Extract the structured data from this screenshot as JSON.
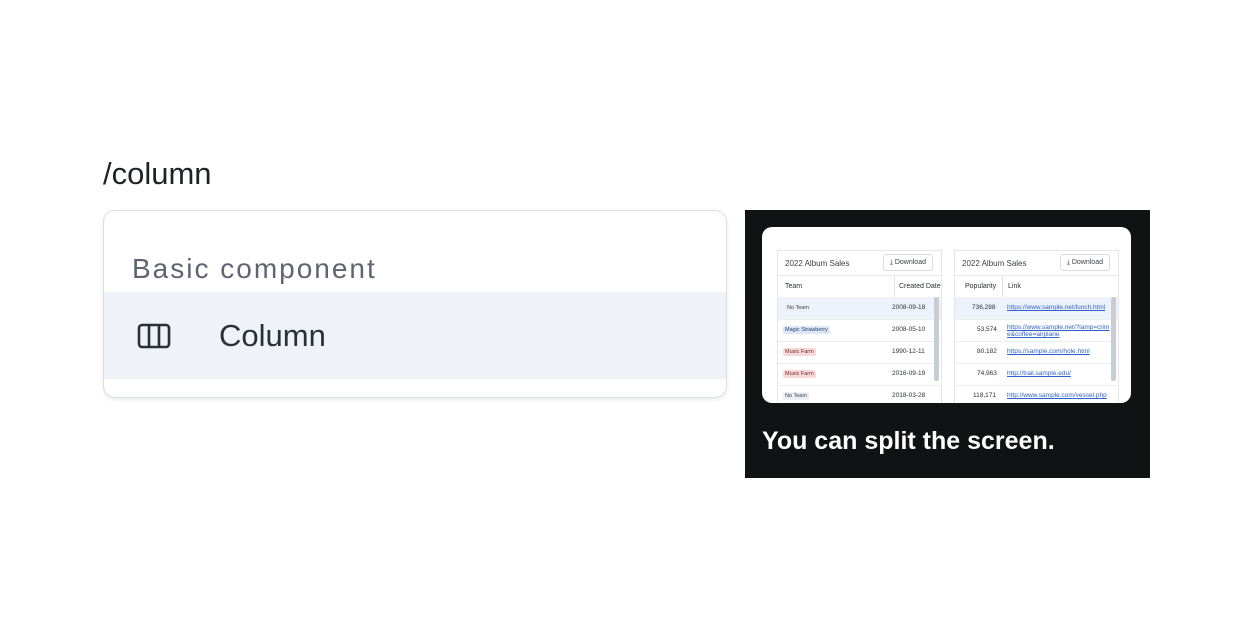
{
  "command": "/column",
  "menu": {
    "group_title": "Basic component",
    "items": [
      {
        "label": "Column",
        "icon": "columns-icon"
      }
    ]
  },
  "preview": {
    "caption": "You can split the screen.",
    "left_panel": {
      "title": "2022 Album Sales",
      "download": "Download",
      "headers": [
        "Team",
        "Created Date"
      ],
      "rows": [
        {
          "team": "No Team",
          "date": "2008-09-18"
        },
        {
          "team": "Magic Strawberry",
          "date": "2008-05-10"
        },
        {
          "team": "Music Farm",
          "date": "1990-12-11"
        },
        {
          "team": "Music Farm",
          "date": "2016-09-19"
        },
        {
          "team": "No Team",
          "date": "2018-03-28"
        }
      ]
    },
    "right_panel": {
      "title": "2022 Album Sales",
      "download": "Download",
      "headers": [
        "Popularity",
        "Link"
      ],
      "rows": [
        {
          "pop": "736,288",
          "link": "https://www.sample.net/lunch.html"
        },
        {
          "pop": "53,574",
          "link": "https://www.sample.net/?lamp=crime&coffee=airplane"
        },
        {
          "pop": "80,182",
          "link": "https://sample.com/hole.html"
        },
        {
          "pop": "74,963",
          "link": "http://trail.sample.edu/"
        },
        {
          "pop": "118,171",
          "link": "http://www.sample.com/vessel.php"
        }
      ]
    }
  }
}
